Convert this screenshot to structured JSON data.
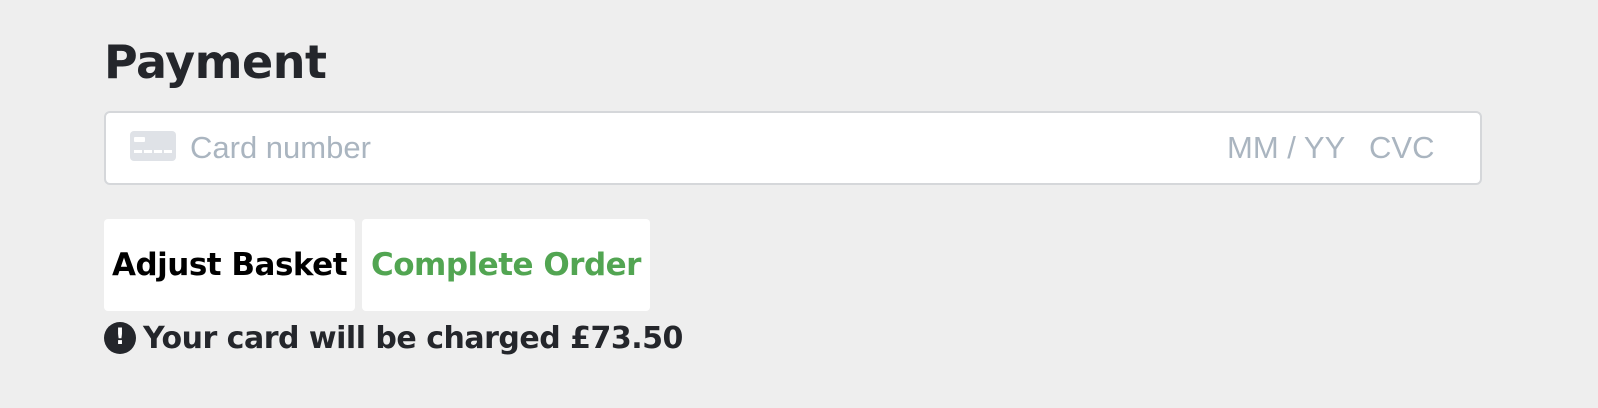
{
  "payment": {
    "title": "Payment",
    "card_field": {
      "icon": "credit-card-icon",
      "number_placeholder": "Card number",
      "expiry_placeholder": "MM / YY",
      "cvc_placeholder": "CVC"
    }
  },
  "actions": {
    "adjust_basket_label": "Adjust Basket",
    "complete_order_label": "Complete Order"
  },
  "notice": {
    "icon": "exclamation-circle-icon",
    "icon_glyph": "!",
    "text": "Your card will be charged £73.50"
  },
  "colors": {
    "background": "#eeeeee",
    "complete_order_text": "#52a552",
    "placeholder": "#aab5c0"
  }
}
